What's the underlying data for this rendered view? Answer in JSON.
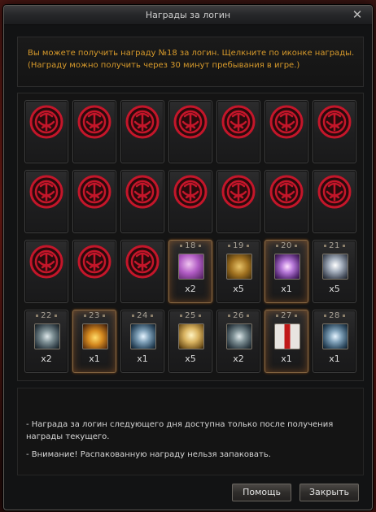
{
  "window": {
    "title": "Награды за логин",
    "close_label": "✕"
  },
  "info": {
    "line1": "Вы можете получить награду №18 за логин. Щелкните по иконке награды.",
    "line2": "(Награду можно получить через 30 минут пребывания в игре.)"
  },
  "colors": {
    "info_text": "#d79a2b",
    "claimed_badge": "#c4162a",
    "current_highlight": "#ff8c28"
  },
  "claimed_icon": "red-seal-icon",
  "rewards": [
    {
      "day": "18",
      "qty": "x2",
      "icon": "pink-crystal-icon"
    },
    {
      "day": "19",
      "qty": "x5",
      "icon": "gold-scroll-icon"
    },
    {
      "day": "20",
      "qty": "x1",
      "icon": "violet-scroll-icon"
    },
    {
      "day": "21",
      "qty": "x5",
      "icon": "silver-crystal-icon"
    },
    {
      "day": "22",
      "qty": "x2",
      "icon": "steel-scroll-icon"
    },
    {
      "day": "23",
      "qty": "x1",
      "icon": "treasure-chest-icon"
    },
    {
      "day": "24",
      "qty": "x1",
      "icon": "blue-scroll-icon"
    },
    {
      "day": "25",
      "qty": "x5",
      "icon": "gold-crystal-icon"
    },
    {
      "day": "26",
      "qty": "x2",
      "icon": "steel-scroll-icon"
    },
    {
      "day": "27",
      "qty": "x1",
      "icon": "gift-box-icon"
    },
    {
      "day": "28",
      "qty": "x1",
      "icon": "blue-scroll-icon"
    }
  ],
  "notes": {
    "line1": " - Награда за логин следующего дня доступна только после получения",
    "line2": "награды текущего.",
    "line3": "- Внимание! Распакованную награду нельзя запаковать."
  },
  "buttons": {
    "help": "Помощь",
    "close": "Закрыть"
  }
}
